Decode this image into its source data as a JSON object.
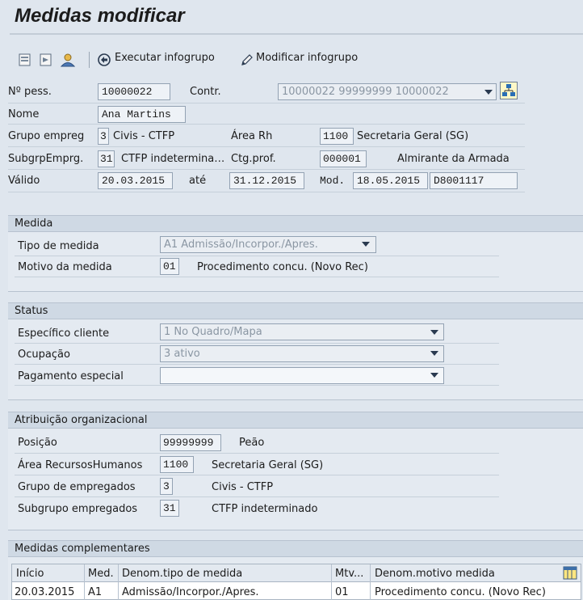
{
  "title": "Medidas modificar",
  "toolbar": {
    "executar": "Executar infogrupo",
    "modificar": "Modificar infogrupo",
    "icons": [
      "prev-record-icon",
      "next-record-icon",
      "person-icon",
      "execute-icon",
      "pencil-icon"
    ]
  },
  "header": {
    "npess_label": "Nº pess.",
    "npess_value": "10000022",
    "contr_label": "Contr.",
    "contr_value": "10000022 99999999 10000022",
    "nome_label": "Nome",
    "nome_value": "Ana Martins",
    "grupo_label": "Grupo empreg",
    "grupo_code": "3",
    "grupo_text": "Civis - CTFP",
    "area_label": "Área Rh",
    "area_code": "1100",
    "area_text": "Secretaria Geral (SG)",
    "subgrp_label": "SubgrpEmprg.",
    "subgrp_code": "31",
    "subgrp_text": "CTFP indetermina…",
    "ctg_label": "Ctg.prof.",
    "ctg_code": "000001",
    "ctg_text": "Almirante da Armada",
    "valido_label": "Válido",
    "valido_from": "20.03.2015",
    "ate_label": "até",
    "valido_to": "31.12.2015",
    "mod_label": "Mod.",
    "mod_date": "18.05.2015",
    "mod_user": "D8001117"
  },
  "medida": {
    "title": "Medida",
    "tipo_label": "Tipo de medida",
    "tipo_value": "A1 Admissão/Incorpor./Apres.",
    "motivo_label": "Motivo da medida",
    "motivo_code": "01",
    "motivo_text": "Procedimento concu. (Novo Rec)"
  },
  "status": {
    "title": "Status",
    "especifico_label": "Específico cliente",
    "especifico_value": "1 No Quadro/Mapa",
    "ocupacao_label": "Ocupação",
    "ocupacao_value": "3 ativo",
    "pagamento_label": "Pagamento especial",
    "pagamento_value": ""
  },
  "atribuicao": {
    "title": "Atribuição organizacional",
    "posicao_label": "Posição",
    "posicao_code": "99999999",
    "posicao_text": "Peão",
    "area_label": "Área RecursosHumanos",
    "area_code": "1100",
    "area_text": "Secretaria Geral (SG)",
    "grupo_label": "Grupo de empregados",
    "grupo_code": "3",
    "grupo_text": "Civis - CTFP",
    "subgrupo_label": "Subgrupo empregados",
    "subgrupo_code": "31",
    "subgrupo_text": "CTFP indeterminado"
  },
  "complementares": {
    "title": "Medidas complementares",
    "columns": [
      "Início",
      "Med.",
      "Denom.tipo de medida",
      "Mtv...",
      "Denom.motivo medida"
    ],
    "rows": [
      [
        "20.03.2015",
        "A1",
        "Admissão/Incorpor./Apres.",
        "01",
        "Procedimento concu. (Novo Rec)"
      ]
    ]
  }
}
